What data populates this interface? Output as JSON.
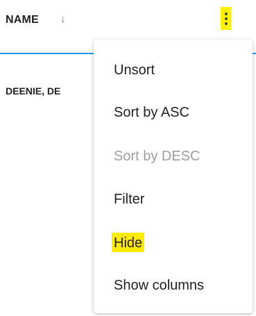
{
  "column": {
    "title": "NAME",
    "sort_icon": "arrow-down-icon",
    "menu_icon": "kebab-menu-icon",
    "highlight_color": "#fff200"
  },
  "table": {
    "rows": [
      "DEENIE, DE"
    ]
  },
  "menu": {
    "items": [
      {
        "label": "Unsort",
        "enabled": true
      },
      {
        "label": "Sort by ASC",
        "enabled": true
      },
      {
        "label": "Sort by DESC",
        "enabled": false
      },
      {
        "label": "Filter",
        "enabled": true
      },
      {
        "label": "Hide",
        "enabled": true,
        "highlighted": true
      },
      {
        "label": "Show columns",
        "enabled": true
      }
    ]
  },
  "colors": {
    "header_border": "#2196f3",
    "text": "#212121",
    "disabled_text": "#9e9e9e"
  }
}
